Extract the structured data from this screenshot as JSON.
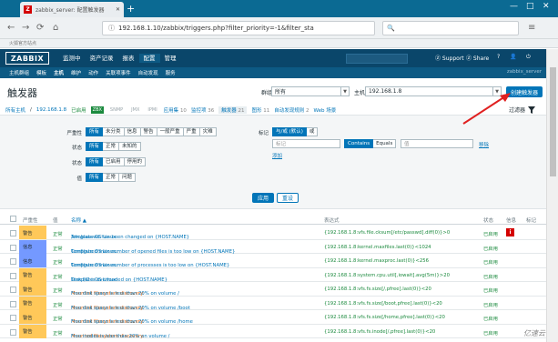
{
  "browser": {
    "tab_title": "zabbix_server: 配置触发器",
    "url": "192.168.1.10/zabbix/triggers.php?filter_priority=-1&filter_sta",
    "bookmark": "火狐官方站点"
  },
  "header": {
    "logo": "ZABBIX",
    "nav": [
      "监测中",
      "资产记录",
      "报表",
      "配置",
      "管理"
    ],
    "support": "Support",
    "share": "Share",
    "server": "zabbix_server"
  },
  "subnav": {
    "items": [
      "主机群组",
      "模板",
      "主机",
      "维护",
      "动作",
      "关联项事件",
      "自动发现",
      "服务"
    ]
  },
  "page": {
    "title": "触发器",
    "group_label": "群组",
    "group_value": "所有",
    "host_label": "主机",
    "host_value": "192.168.1.8",
    "create_button": "创建触发器"
  },
  "crumbs": {
    "all_hosts": "所有主机",
    "host": "192.168.1.8",
    "status": "已启用",
    "zbx": "ZBX",
    "snmp": "SNMP",
    "jmx": "JMX",
    "ipmi": "IPMI",
    "apps_label": "应用集",
    "apps_count": "10",
    "items_label": "监控项",
    "items_count": "36",
    "triggers_label": "触发器",
    "triggers_count": "21",
    "graphs_label": "图形",
    "graphs_count": "11",
    "discovery_label": "自动发现规则",
    "discovery_count": "2",
    "web_label": "Web 场景",
    "filter_label": "过滤器"
  },
  "filter": {
    "severity_label": "严重性",
    "severity_options": [
      "所有",
      "未分类",
      "信息",
      "警告",
      "一般严重",
      "严重",
      "灾难"
    ],
    "state_label": "状态",
    "state_options": [
      "所有",
      "正常",
      "未知的"
    ],
    "status_label": "状态",
    "status_options": [
      "所有",
      "已启用",
      "停用的"
    ],
    "value_label": "值",
    "value_options": [
      "所有",
      "正常",
      "问题"
    ],
    "tags_label": "标记",
    "tags_mode": [
      "与/或 (默认)",
      "或"
    ],
    "tag_placeholder": "标记",
    "contains": "Contains",
    "equals": "Equals",
    "value_placeholder": "值",
    "remove": "移除",
    "add": "添加",
    "apply": "应用",
    "reset": "重设"
  },
  "table": {
    "headers": [
      "严重性",
      "值",
      "名称 ▲",
      "表达式",
      "状态",
      "信息",
      "标记"
    ],
    "rows": [
      {
        "severity": "警告",
        "color": "#ffc859",
        "value": "正常",
        "template": "Template OS Linux: ",
        "name": "/etc/passwd has been changed on {HOST.NAME}",
        "expression": "{192.168.1.8:vfs.file.cksum[/etc/passwd].diff(0)}>0",
        "status": "已启用",
        "info": true
      },
      {
        "severity": "信息",
        "color": "#7499ff",
        "value": "正常",
        "template": "Template OS Linux: ",
        "name": "Configured max number of opened files is too low on {HOST.NAME}",
        "expression": "{192.168.1.8:kernel.maxfiles.last(0)}<1024",
        "status": "已启用",
        "info": false
      },
      {
        "severity": "信息",
        "color": "#7499ff",
        "value": "正常",
        "template": "Template OS Linux: ",
        "name": "Configured max number of processes is too low on {HOST.NAME}",
        "expression": "{192.168.1.8:kernel.maxproc.last(0)}<256",
        "status": "已启用",
        "info": false
      },
      {
        "severity": "警告",
        "color": "#ffc859",
        "value": "正常",
        "template": "Template OS Linux: ",
        "name": "Disk I/O is overloaded on {HOST.NAME}",
        "expression": "{192.168.1.8:system.cpu.util[,iowait].avg(5m)}>20",
        "status": "已启用",
        "info": false
      },
      {
        "severity": "警告",
        "color": "#ffc859",
        "value": "正常",
        "template": "Mounted filesystem discovery: ",
        "name": "Free disk space is less than 20% on volume /",
        "expression": "{192.168.1.8:vfs.fs.size[/,pfree].last(0)}<20",
        "status": "已启用",
        "info": false
      },
      {
        "severity": "警告",
        "color": "#ffc859",
        "value": "正常",
        "template": "Mounted filesystem discovery: ",
        "name": "Free disk space is less than 20% on volume /boot",
        "expression": "{192.168.1.8:vfs.fs.size[/boot,pfree].last(0)}<20",
        "status": "已启用",
        "info": false
      },
      {
        "severity": "警告",
        "color": "#ffc859",
        "value": "正常",
        "template": "Mounted filesystem discovery: ",
        "name": "Free disk space is less than 20% on volume /home",
        "expression": "{192.168.1.8:vfs.fs.size[/home,pfree].last(0)}<20",
        "status": "已启用",
        "info": false
      },
      {
        "severity": "警告",
        "color": "#ffc859",
        "value": "正常",
        "template": "Mounted filesystem discovery: ",
        "name": "Free inodes is less than 20% on volume /",
        "expression": "{192.168.1.8:vfs.fs.inode[/,pfree].last(0)}<20",
        "status": "已启用",
        "info": false
      }
    ]
  },
  "watermark": "亿速云"
}
